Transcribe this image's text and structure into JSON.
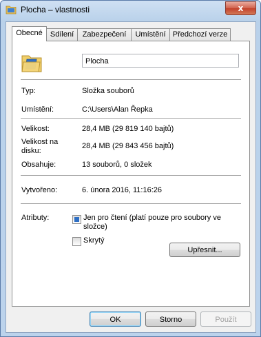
{
  "window": {
    "title": "Plocha – vlastnosti",
    "close_label": "x"
  },
  "tabs": [
    {
      "label": "Obecné"
    },
    {
      "label": "Sdílení"
    },
    {
      "label": "Zabezpečení"
    },
    {
      "label": "Umístění"
    },
    {
      "label": "Předchozí verze"
    }
  ],
  "general": {
    "name": "Plocha",
    "type_label": "Typ:",
    "type_value": "Složka souborů",
    "location_label": "Umístění:",
    "location_value": "C:\\Users\\Alan Řepka",
    "size_label": "Velikost:",
    "size_value": "28,4 MB (29 819 140 bajtů)",
    "disk_size_label": "Velikost na disku:",
    "disk_size_value": "28,4 MB (29 843 456 bajtů)",
    "contains_label": "Obsahuje:",
    "contains_value": "13 souborů, 0 složek",
    "created_label": "Vytvořeno:",
    "created_value": "6. února 2016, 11:16:26",
    "attributes_label": "Atributy:",
    "readonly_label": "Jen pro čtení (platí pouze pro soubory ve složce)",
    "hidden_label": "Skrytý",
    "advanced_button": "Upřesnit..."
  },
  "footer": {
    "ok": "OK",
    "cancel": "Storno",
    "apply": "Použít"
  }
}
